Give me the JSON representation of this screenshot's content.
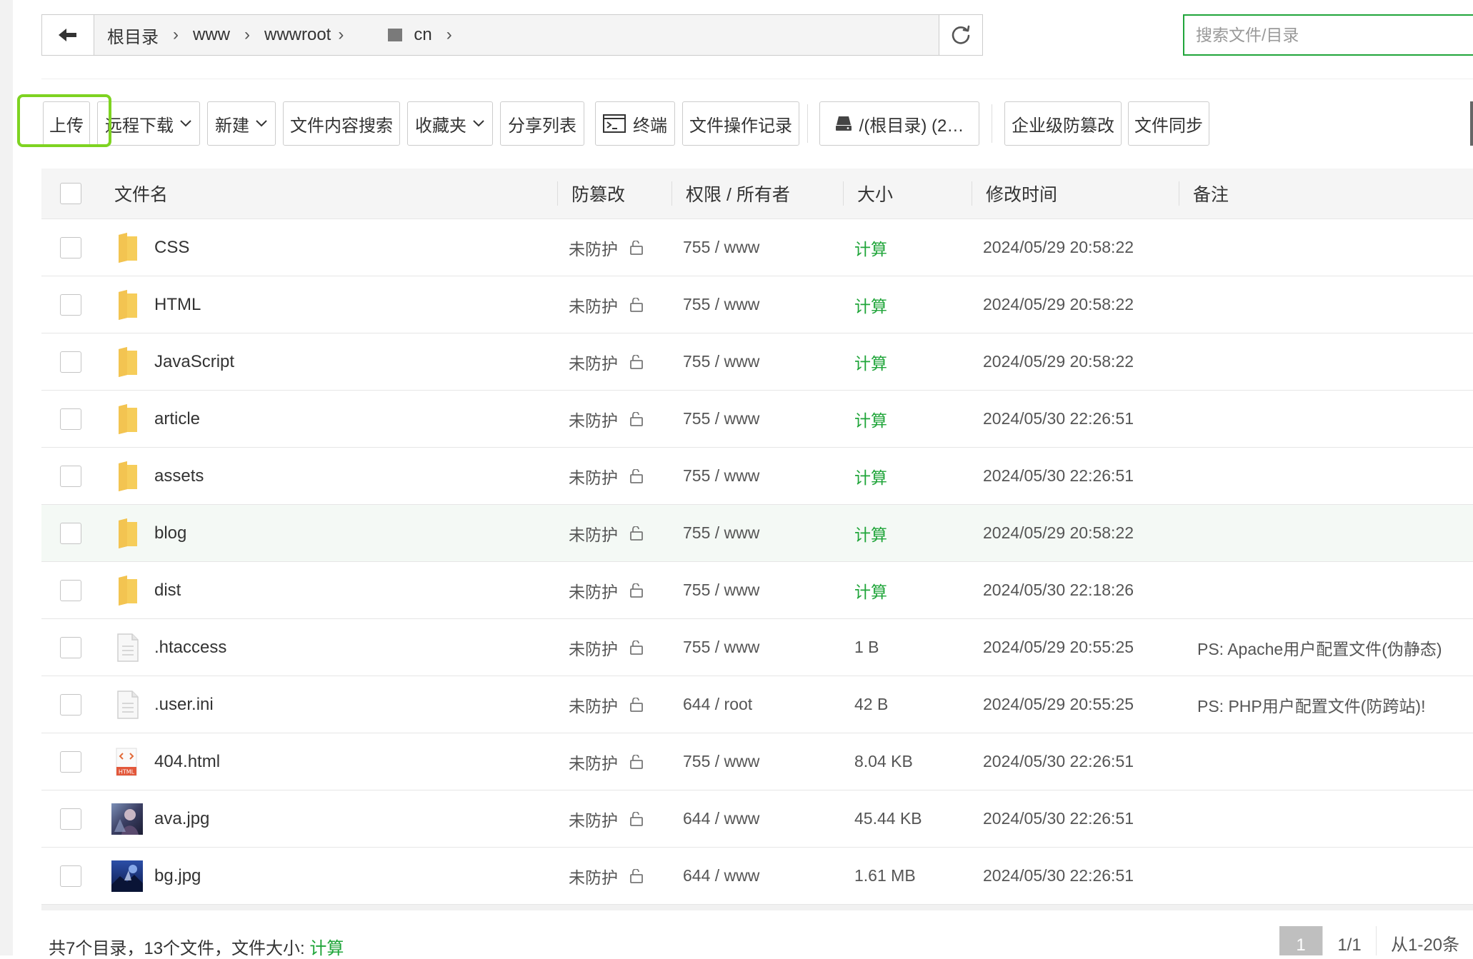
{
  "breadcrumb": {
    "items": [
      "根目录",
      "www",
      "wwwroot",
      "cn"
    ]
  },
  "search": {
    "placeholder": "搜索文件/目录"
  },
  "toolbar": {
    "upload": "上传",
    "remote_download": "远程下载",
    "new": "新建",
    "content_search": "文件内容搜索",
    "favorites": "收藏夹",
    "share_list": "分享列表",
    "terminal": "终端",
    "op_log": "文件操作记录",
    "disk": "/(根目录) (2…",
    "tamper_proof": "企业级防篡改",
    "file_sync": "文件同步"
  },
  "table": {
    "headers": {
      "name": "文件名",
      "tamper": "防篡改",
      "perm": "权限 / 所有者",
      "size": "大小",
      "mtime": "修改时间",
      "note": "备注"
    },
    "rows": [
      {
        "name": "CSS",
        "type": "folder",
        "tamper": "未防护",
        "perm": "755 / www",
        "size": "计算",
        "mtime": "2024/05/29 20:58:22",
        "note": ""
      },
      {
        "name": "HTML",
        "type": "folder",
        "tamper": "未防护",
        "perm": "755 / www",
        "size": "计算",
        "mtime": "2024/05/29 20:58:22",
        "note": ""
      },
      {
        "name": "JavaScript",
        "type": "folder",
        "tamper": "未防护",
        "perm": "755 / www",
        "size": "计算",
        "mtime": "2024/05/29 20:58:22",
        "note": ""
      },
      {
        "name": "article",
        "type": "folder",
        "tamper": "未防护",
        "perm": "755 / www",
        "size": "计算",
        "mtime": "2024/05/30 22:26:51",
        "note": ""
      },
      {
        "name": "assets",
        "type": "folder",
        "tamper": "未防护",
        "perm": "755 / www",
        "size": "计算",
        "mtime": "2024/05/30 22:26:51",
        "note": ""
      },
      {
        "name": "blog",
        "type": "folder",
        "tamper": "未防护",
        "perm": "755 / www",
        "size": "计算",
        "mtime": "2024/05/29 20:58:22",
        "note": ""
      },
      {
        "name": "dist",
        "type": "folder",
        "tamper": "未防护",
        "perm": "755 / www",
        "size": "计算",
        "mtime": "2024/05/30 22:18:26",
        "note": ""
      },
      {
        "name": ".htaccess",
        "type": "file",
        "tamper": "未防护",
        "perm": "755 / www",
        "size": "1 B",
        "mtime": "2024/05/29 20:55:25",
        "note": "PS: Apache用户配置文件(伪静态)"
      },
      {
        "name": ".user.ini",
        "type": "file",
        "tamper": "未防护",
        "perm": "644 / root",
        "size": "42 B",
        "mtime": "2024/05/29 20:55:25",
        "note": "PS: PHP用户配置文件(防跨站)!"
      },
      {
        "name": "404.html",
        "type": "html",
        "tamper": "未防护",
        "perm": "755 / www",
        "size": "8.04 KB",
        "mtime": "2024/05/30 22:26:51",
        "note": ""
      },
      {
        "name": "ava.jpg",
        "type": "image-ava",
        "tamper": "未防护",
        "perm": "644 / www",
        "size": "45.44 KB",
        "mtime": "2024/05/30 22:26:51",
        "note": ""
      },
      {
        "name": "bg.jpg",
        "type": "image-bg",
        "tamper": "未防护",
        "perm": "644 / www",
        "size": "1.61 MB",
        "mtime": "2024/05/30 22:26:51",
        "note": ""
      }
    ]
  },
  "footer": {
    "summary_prefix": "共7个目录，13个文件，文件大小: ",
    "summary_calc": "计算",
    "page_current": "1",
    "page_total": "1/1",
    "page_range": "从1-20条"
  },
  "colors": {
    "accent": "#20a53a",
    "highlight_border": "#7ed321",
    "folder": "#f6cd5a"
  }
}
